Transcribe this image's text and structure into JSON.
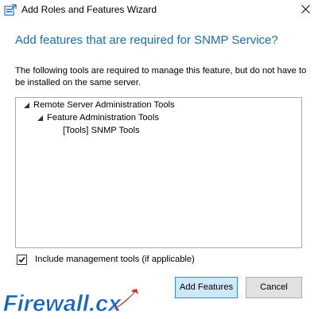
{
  "window": {
    "title": "Add Roles and Features Wizard",
    "app_icon": "server-manager-icon",
    "close_icon": "close-icon"
  },
  "dialog": {
    "heading": "Add features that are required for SNMP Service?",
    "description": "The following tools are required to manage this feature, but do not have to be installed on the same server.",
    "tree": [
      {
        "label": "Remote Server Administration Tools",
        "expanded": true
      },
      {
        "label": "Feature Administration Tools",
        "expanded": true
      },
      {
        "label": "[Tools] SNMP Tools",
        "expanded": false
      }
    ],
    "include_tools": {
      "checked": true,
      "label": "Include management tools (if applicable)"
    },
    "buttons": {
      "add": "Add Features",
      "cancel": "Cancel"
    }
  },
  "watermark": {
    "text": "Firewall.cx"
  },
  "colors": {
    "heading": "#1e6aa8",
    "primary_button_bg": "#cde8f8",
    "primary_button_border": "#2f8fd0",
    "watermark_blue": "#1565c0",
    "watermark_red": "#d32f2f"
  }
}
